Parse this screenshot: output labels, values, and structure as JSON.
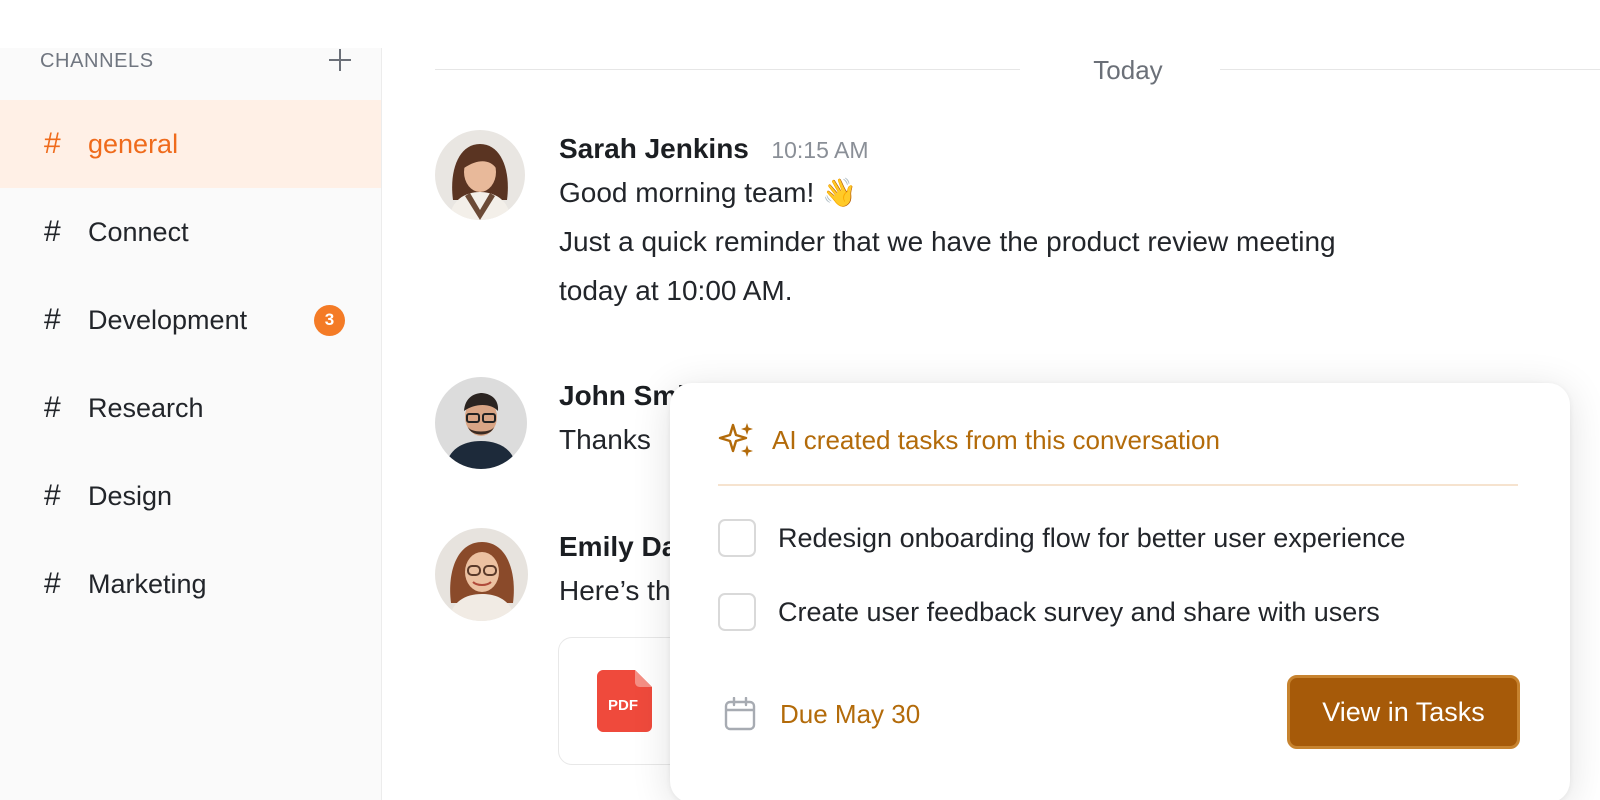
{
  "sidebar": {
    "title": "CHANNELS",
    "add_icon": "plus-icon",
    "channels": [
      {
        "hash": "#",
        "name": "general",
        "active": true
      },
      {
        "hash": "#",
        "name": "Connect"
      },
      {
        "hash": "#",
        "name": "Development",
        "badge": "3"
      },
      {
        "hash": "#",
        "name": "Research"
      },
      {
        "hash": "#",
        "name": "Design"
      },
      {
        "hash": "#",
        "name": "Marketing"
      }
    ]
  },
  "chat": {
    "date_divider": "Today",
    "messages": [
      {
        "author": "Sarah Jenkins",
        "time": "10:15 AM",
        "line1": "Good morning team! 👋",
        "line2": "Just a quick reminder that we have the product review meeting",
        "line3": "today at 10:00 AM."
      },
      {
        "author": "John Smi",
        "line1": "Thanks"
      },
      {
        "author": "Emily Da",
        "line1": "Here’s th"
      }
    ],
    "attachment": {
      "type_label": "PDF",
      "icon": "pdf-file-icon"
    }
  },
  "ai_panel": {
    "icon": "sparkle-icon",
    "title": "AI created tasks from this conversation",
    "tasks": [
      {
        "label": "Redesign onboarding flow for better user experience",
        "checked": false
      },
      {
        "label": "Create user feedback survey and share with users",
        "checked": false
      }
    ],
    "due_icon": "calendar-icon",
    "due_label": "Due May 30",
    "button_label": "View in Tasks"
  },
  "colors": {
    "accent_orange": "#ef6b1c",
    "ai_text": "#b36b0a",
    "button_brown": "#a65a09",
    "badge_orange": "#f47b26"
  }
}
